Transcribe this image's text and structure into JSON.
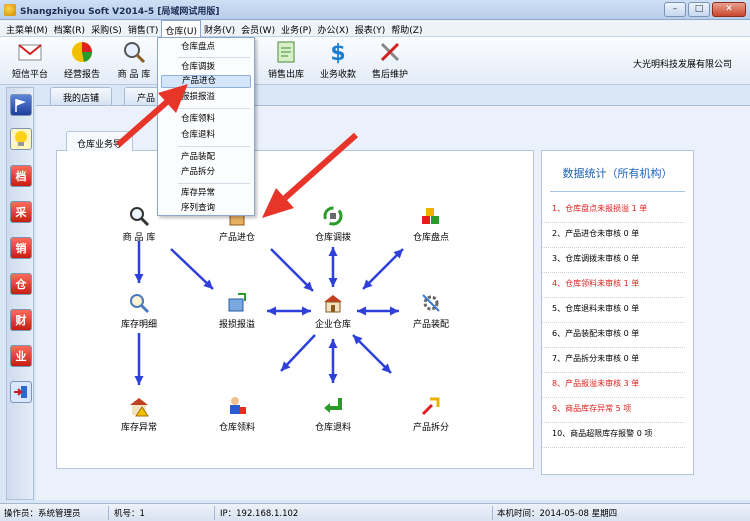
{
  "window": {
    "title": "Shangzhiyou Soft V2014-5 [局域网试用版]"
  },
  "menu": [
    {
      "label": "主菜单(M)"
    },
    {
      "label": "档案(R)"
    },
    {
      "label": "采购(S)"
    },
    {
      "label": "销售(T)"
    },
    {
      "label": "仓库(U)",
      "active": true
    },
    {
      "label": "财务(V)"
    },
    {
      "label": "会员(W)"
    },
    {
      "label": "业务(P)"
    },
    {
      "label": "办公(X)"
    },
    {
      "label": "报表(Y)"
    },
    {
      "label": "帮助(Z)"
    }
  ],
  "toolbar": {
    "items": [
      {
        "label": "短信平台",
        "icon": "envelope-icon"
      },
      {
        "label": "经营报告",
        "icon": "pie-chart-icon"
      },
      {
        "label": "商 品 库",
        "icon": "magnifier-icon"
      },
      {
        "label": "销售出库",
        "icon": "document-icon"
      },
      {
        "label": "业务收款",
        "icon": "dollar-icon"
      },
      {
        "label": "售后维护",
        "icon": "tools-icon"
      }
    ],
    "company": "大光明科技发展有限公司"
  },
  "tabs": [
    {
      "label": "我的店铺"
    },
    {
      "label": "产品"
    }
  ],
  "sidebar": [
    {
      "icon": "flag-icon",
      "text": ""
    },
    {
      "icon": "bulb-icon",
      "text": ""
    },
    {
      "icon": "archive-icon",
      "text": "档"
    },
    {
      "icon": "purchase-icon",
      "text": "采"
    },
    {
      "icon": "sales-icon",
      "text": "销"
    },
    {
      "icon": "warehouse-icon",
      "text": "仓"
    },
    {
      "icon": "finance-icon",
      "text": "财"
    },
    {
      "icon": "business-icon",
      "text": "业"
    },
    {
      "icon": "exit-icon",
      "text": ""
    }
  ],
  "dropdown": {
    "items": [
      {
        "label": "仓库盘点"
      },
      {
        "label": "仓库调拨"
      },
      {
        "label": "产品进仓",
        "hover": true
      },
      {
        "label": "报损报溢"
      },
      {
        "label": "仓库领料"
      },
      {
        "label": "仓库退料"
      },
      {
        "label": "产品装配"
      },
      {
        "label": "产品拆分"
      },
      {
        "label": "库存异常"
      },
      {
        "label": "序列查询"
      }
    ]
  },
  "flow": {
    "tab_label": "仓库业务导",
    "nodes": {
      "product_lib": {
        "label": "商 品 库",
        "icon": "magnifier-icon"
      },
      "product_in": {
        "label": "产品进仓",
        "icon": "box-in-icon"
      },
      "transfer": {
        "label": "仓库调拨",
        "icon": "transfer-icon"
      },
      "stocktake": {
        "label": "仓库盘点",
        "icon": "boxes-icon"
      },
      "stock_detail": {
        "label": "库存明细",
        "icon": "search-icon"
      },
      "loss_gain": {
        "label": "报损报溢",
        "icon": "loss-gain-icon"
      },
      "enterprise_wh": {
        "label": "企业仓库",
        "icon": "warehouse-icon"
      },
      "assembly": {
        "label": "产品装配",
        "icon": "assembly-icon"
      },
      "stock_abnormal": {
        "label": "库存异常",
        "icon": "warning-house-icon"
      },
      "picking": {
        "label": "仓库领料",
        "icon": "worker-icon"
      },
      "return": {
        "label": "仓库退料",
        "icon": "return-arrow-icon"
      },
      "split": {
        "label": "产品拆分",
        "icon": "split-icon"
      }
    }
  },
  "stats": {
    "title": "数据统计（所有机构）",
    "items": [
      {
        "text": "1、仓库盘点未报损溢 1 单",
        "red": true
      },
      {
        "text": "2、产品进仓未审核 0 单",
        "red": false
      },
      {
        "text": "3、仓库调拨未审核 0 单",
        "red": false
      },
      {
        "text": "4、仓库领料未审核 1 单",
        "red": true
      },
      {
        "text": "5、仓库退料未审核 0 单",
        "red": false
      },
      {
        "text": "6、产品装配未审核 0 单",
        "red": false
      },
      {
        "text": "7、产品拆分未审核 0 单",
        "red": false
      },
      {
        "text": "8、产品报溢未审核 3 单",
        "red": true
      },
      {
        "text": "9、商品库存异常 5 项",
        "red": true
      },
      {
        "text": "10、商品超限库存报警 0 项",
        "red": false
      }
    ]
  },
  "colors": {
    "flow_arrow": "#2f3fd9",
    "annotation_arrow": "#e8352a",
    "stat_alert": "#e02020",
    "stats_title": "#1a63b8"
  },
  "statusbar": {
    "operator": "操作员：系统管理员",
    "machine": "机号：1",
    "ip": "IP：192.168.1.102",
    "time": "本机时间：2014-05-08 星期四"
  }
}
